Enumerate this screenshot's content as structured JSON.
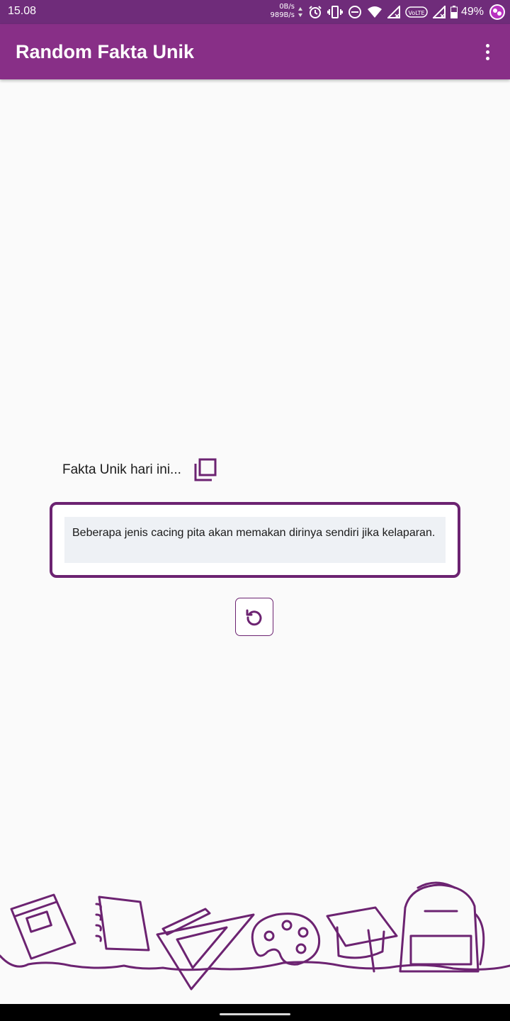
{
  "status_bar": {
    "time": "15.08",
    "speed_up": "0B/s",
    "speed_down": "989B/s",
    "battery": "49%",
    "icons": [
      "data-arrows-icon",
      "alarm-icon",
      "vibrate-icon",
      "do-not-disturb-icon",
      "wifi-icon",
      "signal-icon",
      "volte-icon",
      "signal-no-service-icon",
      "battery-icon",
      "app-notification-icon"
    ]
  },
  "app_bar": {
    "title": "Random Fakta Unik",
    "menu_icon": "more-vert-icon",
    "color": "#882f87"
  },
  "content": {
    "label": "Fakta Unik hari ini...",
    "copy_icon": "copy-icon",
    "fact": "Beberapa jenis cacing pita akan memakan dirinya sendiri jika kelaparan.",
    "refresh_icon": "refresh-icon",
    "accent_color": "#6c2371"
  },
  "decoration": {
    "name": "school-supplies-line-art",
    "color": "#6c2371"
  }
}
